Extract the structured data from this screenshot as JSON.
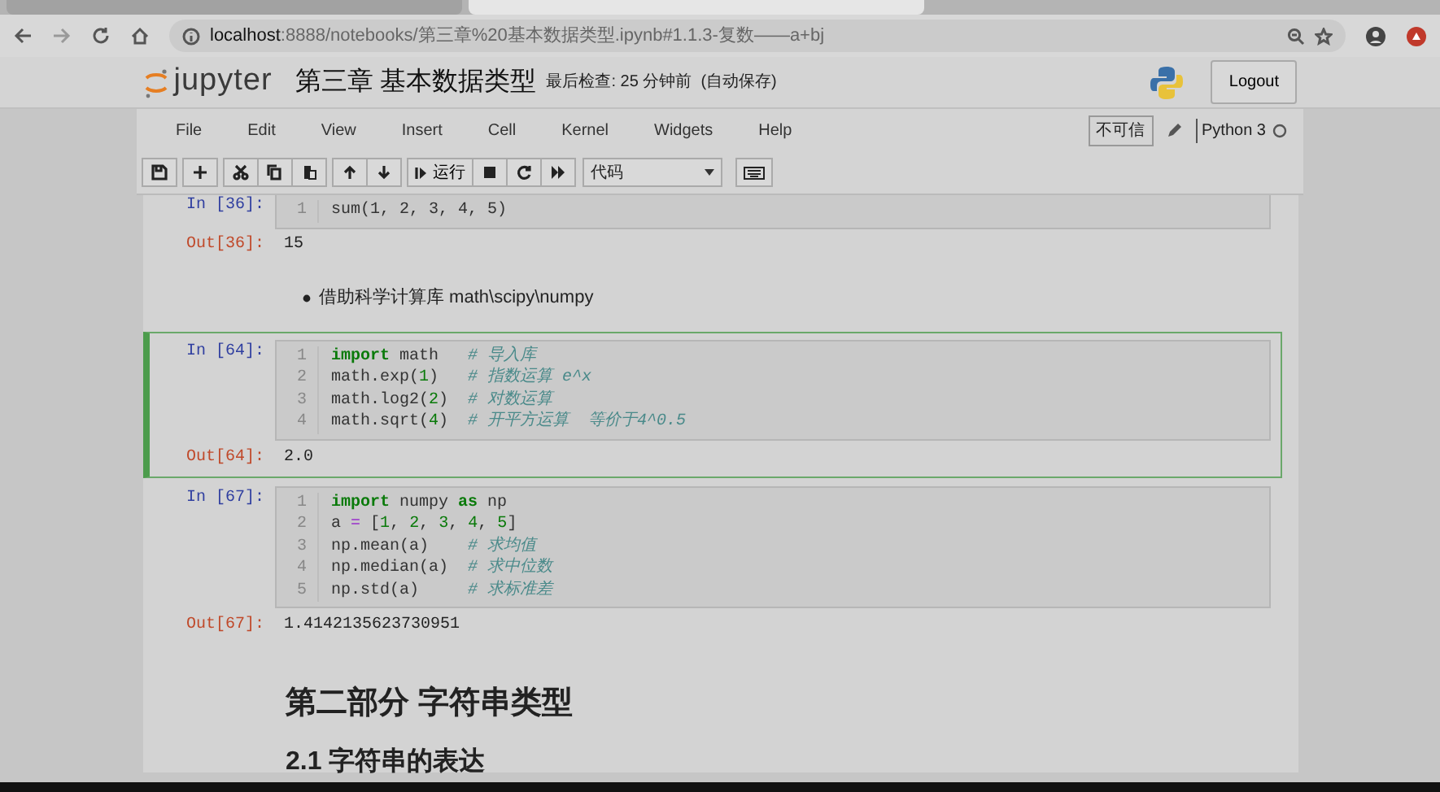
{
  "browser": {
    "tabs": [
      {
        "selected": false
      },
      {
        "selected": true
      }
    ],
    "url_host": "localhost",
    "url_path": ":8888/notebooks/第三章%20基本数据类型.ipynb#1.1.3-复数——a+bj"
  },
  "header": {
    "logo": "jupyter",
    "title": "第三章 基本数据类型",
    "checkpoint": "最后检查: 25 分钟前",
    "autosave": "(自动保存)",
    "logout": "Logout"
  },
  "menu": {
    "items": [
      "File",
      "Edit",
      "View",
      "Insert",
      "Cell",
      "Kernel",
      "Widgets",
      "Help"
    ],
    "trust": "不可信",
    "kernel": "Python 3"
  },
  "toolbar": {
    "run_label": "运行",
    "cell_type": "代码"
  },
  "cells": [
    {
      "kind": "code",
      "selected": false,
      "prompt": "In [36]:",
      "lines": [
        {
          "number": "1",
          "segments": [
            {
              "kind": "plain",
              "text": "sum(1, 2, 3, 4, 5)"
            }
          ]
        }
      ],
      "out_prompt": "Out[36]:",
      "output": "15"
    },
    {
      "kind": "bullet",
      "text": "借助科学计算库 math\\scipy\\numpy"
    },
    {
      "kind": "code",
      "selected": true,
      "prompt": "In [64]:",
      "lines": [
        {
          "number": "1",
          "segments": [
            {
              "kind": "keyword",
              "text": "import"
            },
            {
              "kind": "plain",
              "text": " math   "
            },
            {
              "kind": "comment",
              "text": "# 导入库"
            }
          ]
        },
        {
          "number": "2",
          "segments": [
            {
              "kind": "plain",
              "text": "math.exp("
            },
            {
              "kind": "number",
              "text": "1"
            },
            {
              "kind": "plain",
              "text": ")   "
            },
            {
              "kind": "comment",
              "text": "# 指数运算 e^x"
            }
          ]
        },
        {
          "number": "3",
          "segments": [
            {
              "kind": "plain",
              "text": "math.log2("
            },
            {
              "kind": "number",
              "text": "2"
            },
            {
              "kind": "plain",
              "text": ")  "
            },
            {
              "kind": "comment",
              "text": "# 对数运算"
            }
          ]
        },
        {
          "number": "4",
          "segments": [
            {
              "kind": "plain",
              "text": "math.sqrt("
            },
            {
              "kind": "number",
              "text": "4"
            },
            {
              "kind": "plain",
              "text": ")  "
            },
            {
              "kind": "comment",
              "text": "# 开平方运算  等价于4^0.5"
            }
          ]
        }
      ],
      "out_prompt": "Out[64]:",
      "output": "2.0"
    },
    {
      "kind": "code",
      "selected": false,
      "prompt": "In [67]:",
      "lines": [
        {
          "number": "1",
          "segments": [
            {
              "kind": "keyword",
              "text": "import"
            },
            {
              "kind": "plain",
              "text": " numpy "
            },
            {
              "kind": "keyword",
              "text": "as"
            },
            {
              "kind": "plain",
              "text": " np"
            }
          ]
        },
        {
          "number": "2",
          "segments": [
            {
              "kind": "plain",
              "text": "a "
            },
            {
              "kind": "operator",
              "text": "="
            },
            {
              "kind": "plain",
              "text": " ["
            },
            {
              "kind": "number",
              "text": "1"
            },
            {
              "kind": "plain",
              "text": ", "
            },
            {
              "kind": "number",
              "text": "2"
            },
            {
              "kind": "plain",
              "text": ", "
            },
            {
              "kind": "number",
              "text": "3"
            },
            {
              "kind": "plain",
              "text": ", "
            },
            {
              "kind": "number",
              "text": "4"
            },
            {
              "kind": "plain",
              "text": ", "
            },
            {
              "kind": "number",
              "text": "5"
            },
            {
              "kind": "plain",
              "text": "]"
            }
          ]
        },
        {
          "number": "3",
          "segments": [
            {
              "kind": "plain",
              "text": "np.mean(a)    "
            },
            {
              "kind": "comment",
              "text": "# 求均值"
            }
          ]
        },
        {
          "number": "4",
          "segments": [
            {
              "kind": "plain",
              "text": "np.median(a)  "
            },
            {
              "kind": "comment",
              "text": "# 求中位数"
            }
          ]
        },
        {
          "number": "5",
          "segments": [
            {
              "kind": "plain",
              "text": "np.std(a)     "
            },
            {
              "kind": "comment",
              "text": "# 求标准差"
            }
          ]
        }
      ],
      "out_prompt": "Out[67]:",
      "output": "1.4142135623730951"
    },
    {
      "kind": "heading2",
      "text": "第二部分 字符串类型"
    },
    {
      "kind": "heading3",
      "text": "2.1 字符串的表达"
    }
  ]
}
